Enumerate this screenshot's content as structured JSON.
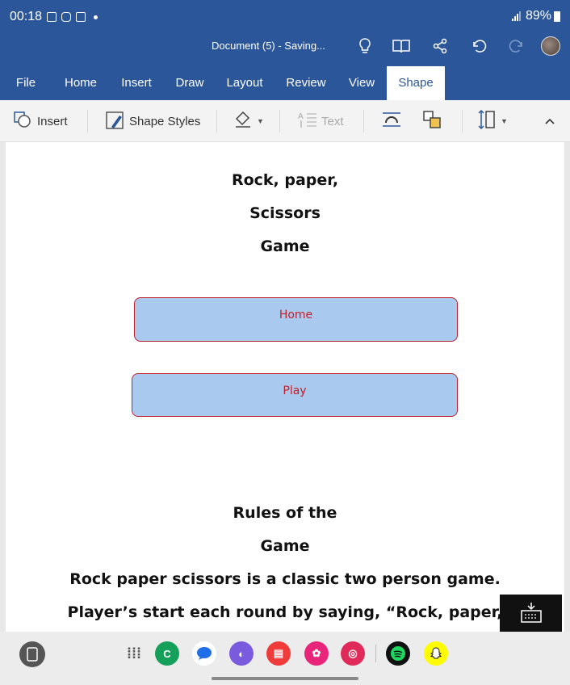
{
  "status_bar": {
    "time": "00:18",
    "battery": "89%"
  },
  "title_bar": {
    "document_title": "Document (5) - Saving..."
  },
  "tabs": [
    {
      "label": "File"
    },
    {
      "label": "Home"
    },
    {
      "label": "Insert"
    },
    {
      "label": "Draw"
    },
    {
      "label": "Layout"
    },
    {
      "label": "Review"
    },
    {
      "label": "View"
    },
    {
      "label": "Shape"
    }
  ],
  "active_tab": "Shape",
  "ribbon": {
    "insert_label": "Insert",
    "shape_styles_label": "Shape Styles",
    "text_label": "Text"
  },
  "document": {
    "title_lines": [
      "Rock, paper,",
      "Scissors",
      "Game"
    ],
    "home_button_text": "Home",
    "play_button_text": "Play",
    "rules_heading_lines": [
      "Rules of the",
      "Game"
    ],
    "body_lines": [
      "Rock paper scissors is a classic two person game.",
      "Player’s start each round by saying, “Rock, paper,"
    ]
  },
  "colors": {
    "word_blue": "#2b579a",
    "shape_fill": "#a9c9ee",
    "shape_border": "#c0212b"
  },
  "icons": [
    "lightbulb-icon",
    "book-icon",
    "share-icon",
    "undo-icon",
    "redo-icon",
    "keyboard-icon"
  ]
}
